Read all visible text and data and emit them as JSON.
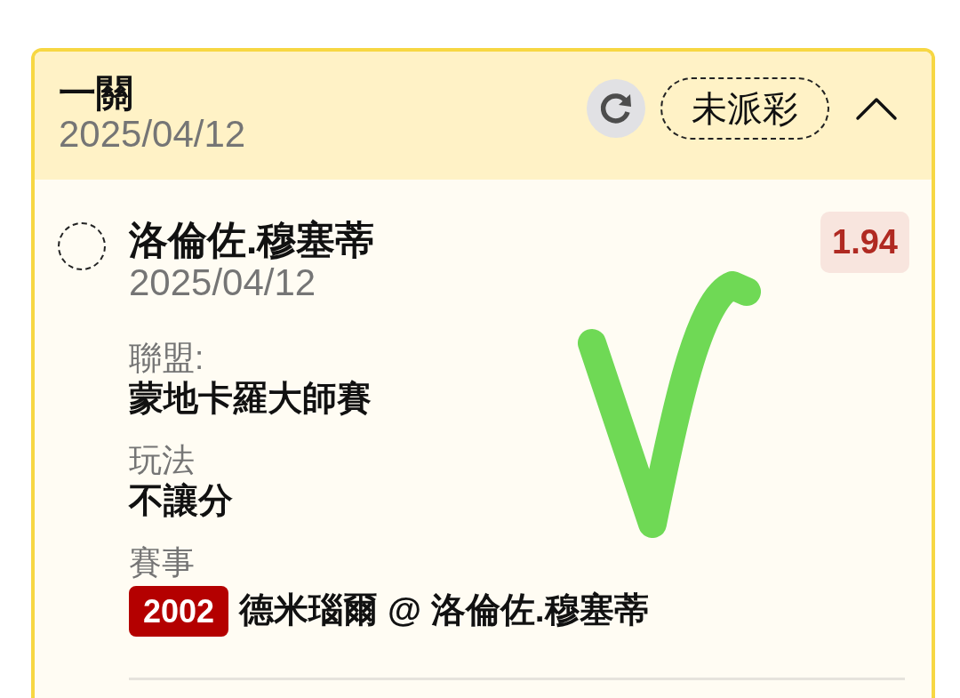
{
  "bet": {
    "title": "一關",
    "date": "2025/04/12",
    "status": "未派彩",
    "expanded": true,
    "legs": [
      {
        "selection": "洛倫佐.穆塞蒂",
        "date": "2025/04/12",
        "odds": "1.94",
        "selected": false,
        "fields": [
          {
            "label": "聯盟:",
            "value": "蒙地卡羅大師賽"
          },
          {
            "label": "玩法",
            "value": "不讓分"
          },
          {
            "label": "賽事",
            "badge": "2002",
            "value": "德米瑙爾 @ 洛倫佐.穆塞蒂"
          }
        ]
      }
    ]
  }
}
